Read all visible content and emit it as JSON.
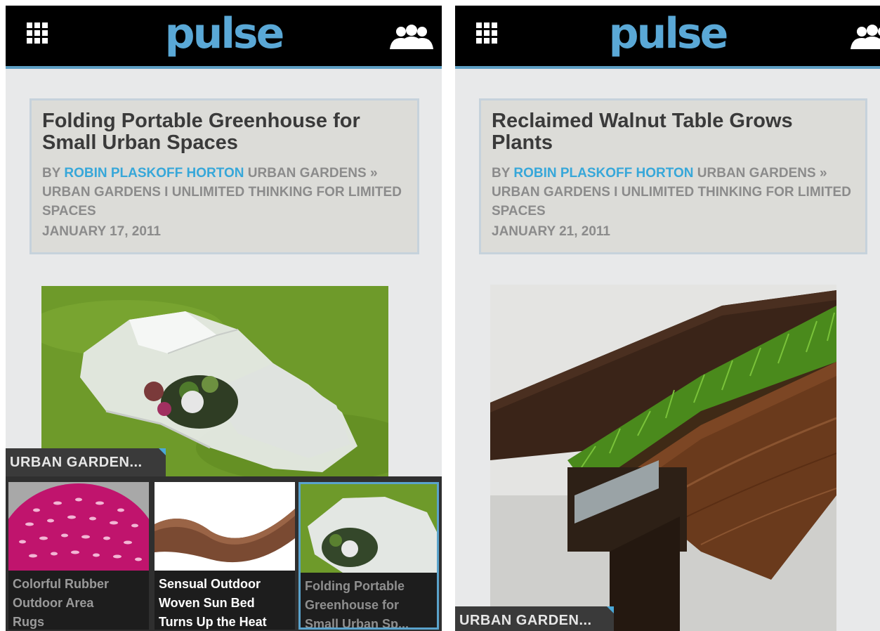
{
  "app": {
    "logo_text": "pulse",
    "accent_color": "#5aa8d6",
    "author_color": "#37a7d9"
  },
  "screens": [
    {
      "article": {
        "title": "Folding Portable Greenhouse for Small Urban Spaces",
        "byline_prefix": "BY",
        "author": "ROBIN PLASKOFF HORTON",
        "source": "URBAN GARDENS » URBAN GARDENS I UNLIMITED THINKING FOR LIMITED SPACES",
        "date": "JANUARY 17, 2011"
      },
      "category_tab": "URBAN GARDEN...",
      "thumbnails": [
        {
          "caption": "Colorful Rubber\nOutdoor Area\nRugs",
          "selected": false
        },
        {
          "caption": "Sensual Outdoor\nWoven Sun Bed\nTurns Up the Heat",
          "selected": false
        },
        {
          "caption": "Folding Portable\nGreenhouse for\nSmall Urban Sp...",
          "selected": true
        }
      ]
    },
    {
      "article": {
        "title": "Reclaimed Walnut Table Grows Plants",
        "byline_prefix": "BY",
        "author": "ROBIN PLASKOFF HORTON",
        "source": "URBAN GARDENS » URBAN GARDENS I UNLIMITED THINKING FOR LIMITED SPACES",
        "date": "JANUARY 21, 2011"
      },
      "category_tab": "URBAN GARDEN..."
    }
  ]
}
